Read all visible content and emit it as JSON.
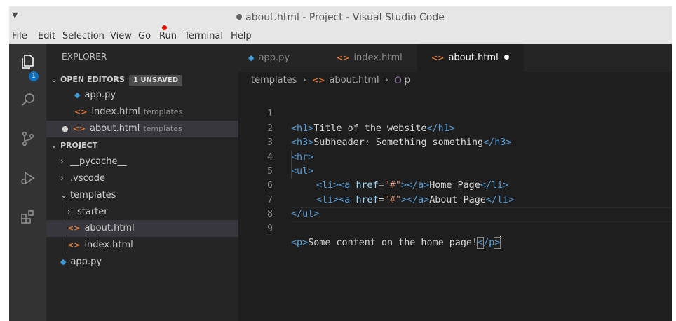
{
  "window": {
    "title": "about.html - Project - Visual Studio Code"
  },
  "menubar": {
    "items": [
      "File",
      "Edit",
      "Selection",
      "View",
      "Go",
      "Run",
      "Terminal",
      "Help"
    ]
  },
  "activitybar": {
    "icons": [
      "explorer-icon",
      "search-icon",
      "source-control-icon",
      "run-debug-icon",
      "extensions-icon"
    ],
    "explorer_badge": "1"
  },
  "sidebar": {
    "header": "EXPLORER",
    "open_editors": {
      "label": "OPEN EDITORS",
      "badge": "1 UNSAVED",
      "items": [
        {
          "name": "app.py",
          "hint": ""
        },
        {
          "name": "index.html",
          "hint": "templates"
        },
        {
          "name": "about.html",
          "hint": "templates"
        }
      ]
    },
    "project": {
      "label": "PROJECT",
      "items": [
        {
          "name": "__pycache__"
        },
        {
          "name": ".vscode"
        },
        {
          "name": "templates"
        },
        {
          "name": "starter"
        },
        {
          "name": "about.html"
        },
        {
          "name": "index.html"
        },
        {
          "name": "app.py"
        }
      ]
    }
  },
  "tabs": [
    {
      "label": "app.py"
    },
    {
      "label": "index.html"
    },
    {
      "label": "about.html"
    }
  ],
  "breadcrumb": {
    "folder": "templates",
    "file": "about.html",
    "symbol": "p"
  },
  "editor": {
    "line_numbers": [
      "1",
      "2",
      "3",
      "4",
      "5",
      "6",
      "7",
      "8",
      "9"
    ],
    "lines": {
      "l1": {
        "open": "<h1>",
        "text": "Title of the website",
        "close": "</h1>"
      },
      "l2": {
        "open": "<h3>",
        "text": "Subheader: Something something",
        "close": "</h3>"
      },
      "l3": {
        "tag": "<hr>"
      },
      "l4": {
        "tag": "<ul>"
      },
      "l5": {
        "li_open": "<li>",
        "a_open": "<a",
        "attr": "href",
        "eq": "=",
        "val": "\"#\"",
        "gt": ">",
        "a_close": "</a>",
        "text": "Home Page",
        "li_close": "</li>"
      },
      "l6": {
        "li_open": "<li>",
        "a_open": "<a",
        "attr": "href",
        "eq": "=",
        "val": "\"#\"",
        "gt": ">",
        "a_close": "</a>",
        "text": "About Page",
        "li_close": "</li>"
      },
      "l7": {
        "tag": "</ul>"
      },
      "l9": {
        "open": "<p>",
        "text": "Some content on the home page!",
        "close_lt": "<",
        "close_rest": "/p",
        "close_gt": ">"
      }
    }
  },
  "colors": {
    "tag": "#569cd6",
    "attribute": "#9cdcfe",
    "string": "#ce9178",
    "text": "#d4d4d4",
    "html_icon": "#e37933",
    "python_icon": "#3e9bd6",
    "badge": "#0e70c0",
    "run_dot": "#e51400"
  }
}
